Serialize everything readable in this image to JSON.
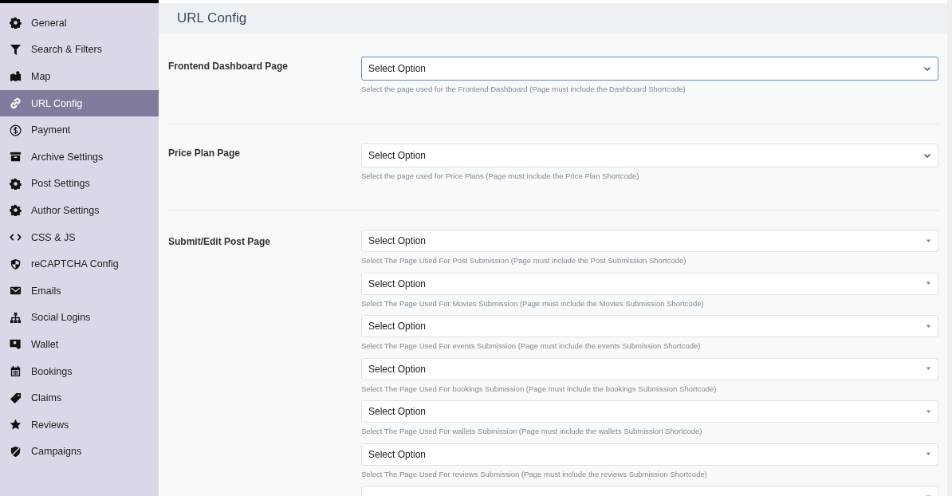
{
  "sidebar": {
    "items": [
      {
        "label": "General",
        "selected": false
      },
      {
        "label": "Search & Filters",
        "selected": false
      },
      {
        "label": "Map",
        "selected": false
      },
      {
        "label": "URL Config",
        "selected": true
      },
      {
        "label": "Payment",
        "selected": false
      },
      {
        "label": "Archive Settings",
        "selected": false
      },
      {
        "label": "Post Settings",
        "selected": false
      },
      {
        "label": "Author Settings",
        "selected": false
      },
      {
        "label": "CSS & JS",
        "selected": false
      },
      {
        "label": "reCAPTCHA Config",
        "selected": false
      },
      {
        "label": "Emails",
        "selected": false
      },
      {
        "label": "Social Logins",
        "selected": false
      },
      {
        "label": "Wallet",
        "selected": false
      },
      {
        "label": "Bookings",
        "selected": false
      },
      {
        "label": "Claims",
        "selected": false
      },
      {
        "label": "Reviews",
        "selected": false
      },
      {
        "label": "Campaigns",
        "selected": false
      }
    ]
  },
  "page": {
    "title": "URL Config",
    "settings": [
      {
        "label": "Frontend Dashboard Page",
        "fields": [
          {
            "kind": "native",
            "value": "Select Option",
            "focused": true,
            "hint": "Select the page used for the Frontend Dashboard (Page must include the Dashboard Shortcode)"
          }
        ]
      },
      {
        "label": "Price Plan Page",
        "fields": [
          {
            "kind": "native",
            "value": "Select Option",
            "focused": false,
            "hint": "Select the page used for Price Plans (Page must include the Price Plan Shortcode)"
          }
        ]
      },
      {
        "label": "Submit/Edit Post Page",
        "fields": [
          {
            "kind": "select2",
            "value": "Select Option",
            "focused": false,
            "hint": "Select The Page Used For Post Submission (Page must include the Post Submission Shortcode)"
          },
          {
            "kind": "select2",
            "value": "Select Option",
            "focused": false,
            "hint": "Select The Page Used For Movies Submission (Page must include the Movies Submission Shortcode)"
          },
          {
            "kind": "select2",
            "value": "Select Option",
            "focused": false,
            "hint": "Select The Page Used For events Submission (Page must include the events Submission Shortcode)"
          },
          {
            "kind": "select2",
            "value": "Select Option",
            "focused": false,
            "hint": "Select The Page Used For bookings Submission (Page must include the bookings Submission Shortcode)"
          },
          {
            "kind": "select2",
            "value": "Select Option",
            "focused": false,
            "hint": "Select The Page Used For wallets Submission (Page must include the wallets Submission Shortcode)"
          },
          {
            "kind": "select2",
            "value": "Select Option",
            "focused": false,
            "hint": "Select The Page Used For reviews Submission (Page must include the reviews Submission Shortcode)"
          },
          {
            "kind": "select2"
          }
        ]
      }
    ]
  }
}
